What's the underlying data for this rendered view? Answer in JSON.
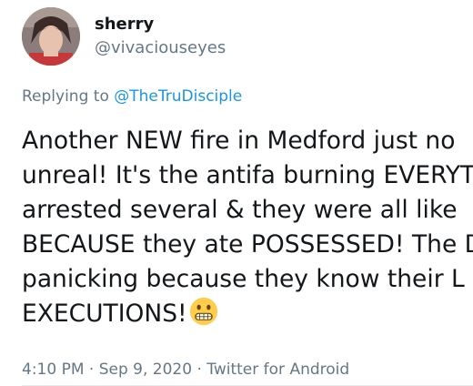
{
  "author": {
    "display_name": "sherry",
    "handle": "@vivaciouseyes",
    "avatar_icon": "profile-photo-avatar"
  },
  "reply": {
    "prefix": "Replying to ",
    "target": "@TheTruDisciple"
  },
  "tweet": {
    "lines": [
      "Another NEW fire in Medford just no",
      "unreal! It's the antifa burning EVERYT",
      "arrested several & they were all like",
      "BECAUSE they ate POSSESSED! The D",
      "panicking because they know their L",
      "EXECUTIONS!"
    ],
    "trailing_emoji": "grimacing-face-emoji"
  },
  "meta": {
    "time": "4:10 PM",
    "separator1": " · ",
    "date": "Sep 9, 2020",
    "separator2": " · ",
    "source": "Twitter for Android"
  },
  "colors": {
    "text": "#14171a",
    "secondary": "#657786",
    "link": "#1b95e0",
    "divider": "#e6ecf0",
    "emoji": "#ffcc4d"
  }
}
